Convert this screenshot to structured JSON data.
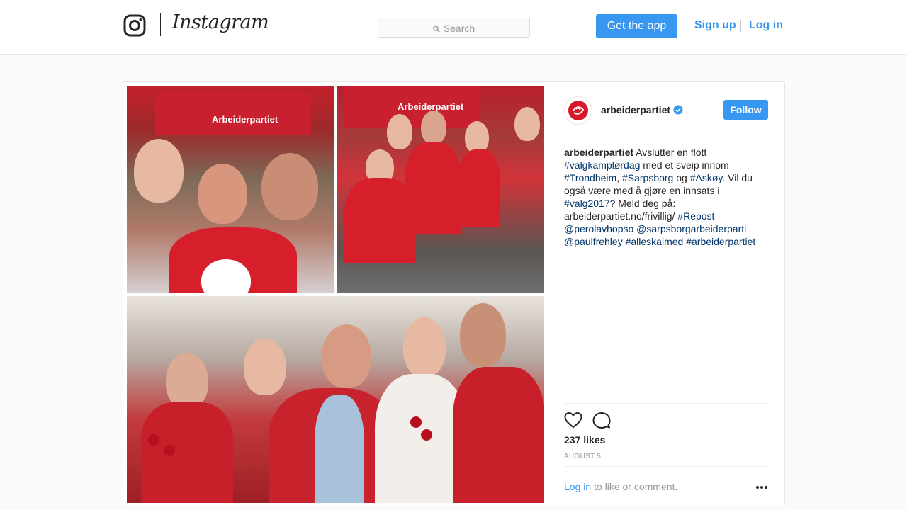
{
  "header": {
    "wordmark": "Instagram",
    "search_placeholder": "Search",
    "get_app_label": "Get the app",
    "signup_label": "Sign up",
    "login_label": "Log in"
  },
  "photo": {
    "tile_a_banner": "Arbeiderpartiet",
    "tile_b_banner": "Arbeiderpartiet"
  },
  "post": {
    "username": "arbeiderpartiet",
    "follow_label": "Follow",
    "caption": {
      "username": "arbeiderpartiet",
      "t1": " Avslutter en flott ",
      "tag1": "#valgkamplørdag",
      "t2": " med et sveip innom ",
      "tag2": "#Trondheim",
      "t3": ", ",
      "tag3": "#Sarpsborg",
      "t4": " og ",
      "tag4": "#Askøy",
      "t5": ". Vil du også være med å gjøre en innsats i ",
      "tag5": "#valg2017",
      "t6": "? Meld deg på: arbeiderpartiet.no/frivillig/ ",
      "tag6": "#Repost",
      "t7": " ",
      "mention1": "@perolavhopso",
      "t8": " ",
      "mention2": "@sarpsborgarbeiderparti",
      "t9": " ",
      "mention3": "@paulfrehley",
      "t10": " ",
      "tag7": "#alleskalmed",
      "t11": " ",
      "tag8": "#arbeiderpartiet"
    },
    "likes": "237 likes",
    "date": "AUGUST 5",
    "login_link": "Log in",
    "login_rest": " to like or comment."
  },
  "colors": {
    "accent": "#3897f0",
    "hashtag": "#003569",
    "brand_red": "#c9202f"
  },
  "icons": [
    "instagram-glyph-icon",
    "search-icon",
    "verified-badge-icon",
    "heart-icon",
    "comment-icon",
    "more-options-icon"
  ]
}
